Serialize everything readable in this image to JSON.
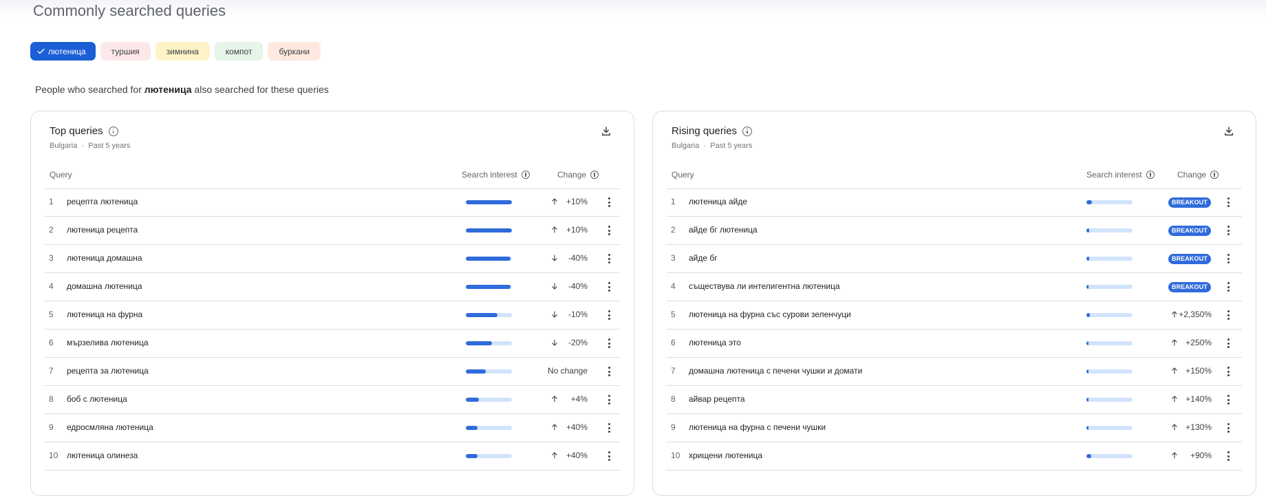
{
  "page": {
    "title": "Commonly searched queries",
    "intro_prefix": "People who searched for ",
    "intro_term": "лютеница",
    "intro_suffix": " also searched for these queries"
  },
  "chips": [
    {
      "label": "лютеница",
      "active": true,
      "bg": "#1b5fd6"
    },
    {
      "label": "туршия",
      "active": false,
      "bg": "#fce8ea"
    },
    {
      "label": "зимнина",
      "active": false,
      "bg": "#fef3c7"
    },
    {
      "label": "компот",
      "active": false,
      "bg": "#e6f4ea"
    },
    {
      "label": "буркани",
      "active": false,
      "bg": "#fde9df"
    }
  ],
  "columns": {
    "query": "Query",
    "interest": "Search interest",
    "change": "Change"
  },
  "top": {
    "title": "Top queries",
    "region": "Bulgaria",
    "period": "Past 5 years",
    "rows": [
      {
        "num": "1",
        "query": "рецепта лютеница",
        "interest": 1.0,
        "dir": "up",
        "change": "+10%"
      },
      {
        "num": "2",
        "query": "лютеница рецепта",
        "interest": 1.0,
        "dir": "up",
        "change": "+10%"
      },
      {
        "num": "3",
        "query": "лютеница домашна",
        "interest": 0.97,
        "dir": "down",
        "change": "-40%"
      },
      {
        "num": "4",
        "query": "домашна лютеница",
        "interest": 0.97,
        "dir": "down",
        "change": "-40%"
      },
      {
        "num": "5",
        "query": "лютеница на фурна",
        "interest": 0.69,
        "dir": "down",
        "change": "-10%"
      },
      {
        "num": "6",
        "query": "мързелива лютеница",
        "interest": 0.57,
        "dir": "down",
        "change": "-20%"
      },
      {
        "num": "7",
        "query": "рецепта за лютеница",
        "interest": 0.43,
        "dir": "none",
        "change": "No change"
      },
      {
        "num": "8",
        "query": "боб с лютеница",
        "interest": 0.29,
        "dir": "up",
        "change": "+4%"
      },
      {
        "num": "9",
        "query": "едросмляна лютеница",
        "interest": 0.25,
        "dir": "up",
        "change": "+40%"
      },
      {
        "num": "10",
        "query": "лютеница олинеза",
        "interest": 0.25,
        "dir": "up",
        "change": "+40%"
      }
    ]
  },
  "rising": {
    "title": "Rising queries",
    "region": "Bulgaria",
    "period": "Past 5 years",
    "rows": [
      {
        "num": "1",
        "query": "лютеница айде",
        "interest": 0.12,
        "dir": "breakout",
        "change": "BREAKOUT"
      },
      {
        "num": "2",
        "query": "айде бг лютеница",
        "interest": 0.06,
        "dir": "breakout",
        "change": "BREAKOUT"
      },
      {
        "num": "3",
        "query": "айде бг",
        "interest": 0.06,
        "dir": "breakout",
        "change": "BREAKOUT"
      },
      {
        "num": "4",
        "query": "съществува ли интелигентна лютеница",
        "interest": 0.04,
        "dir": "breakout",
        "change": "BREAKOUT"
      },
      {
        "num": "5",
        "query": "лютеница на фурна със сурови зеленчуци",
        "interest": 0.07,
        "dir": "up",
        "change": "+2,350%"
      },
      {
        "num": "6",
        "query": "лютеница это",
        "interest": 0.04,
        "dir": "up",
        "change": "+250%"
      },
      {
        "num": "7",
        "query": "домашна лютеница с печени чушки и домати",
        "interest": 0.04,
        "dir": "up",
        "change": "+150%"
      },
      {
        "num": "8",
        "query": "айвар рецепта",
        "interest": 0.04,
        "dir": "up",
        "change": "+140%"
      },
      {
        "num": "9",
        "query": "лютеница на фурна с печени чушки",
        "interest": 0.04,
        "dir": "up",
        "change": "+130%"
      },
      {
        "num": "10",
        "query": "хрищени лютеница",
        "interest": 0.1,
        "dir": "up",
        "change": "+90%"
      }
    ]
  }
}
